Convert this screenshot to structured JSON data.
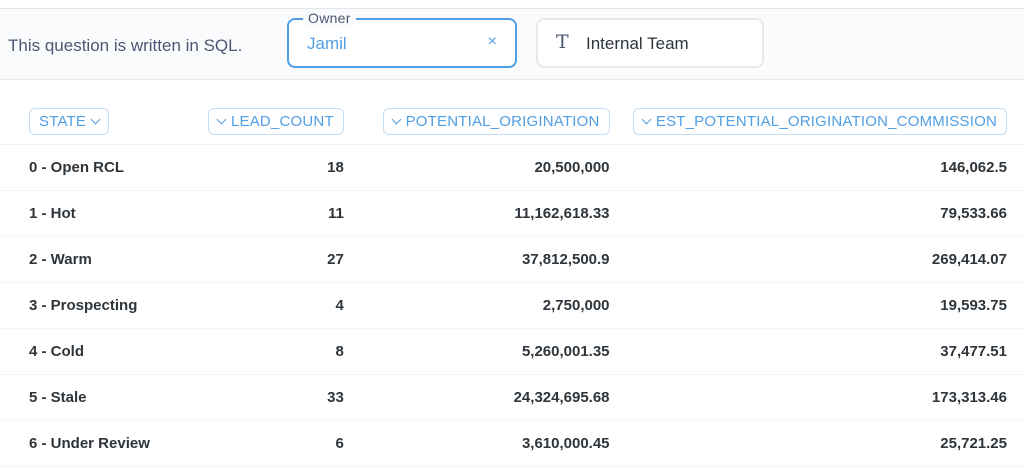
{
  "filter_bar": {
    "note": "This question is written in SQL.",
    "owner_filter": {
      "legend": "Owner",
      "value": "Jamil",
      "clear_icon": "×"
    },
    "team_filter": {
      "type_icon": "T",
      "label": "Internal Team"
    }
  },
  "table": {
    "columns": [
      "STATE",
      "LEAD_COUNT",
      "POTENTIAL_ORIGINATION",
      "EST_POTENTIAL_ORIGINATION_COMMISSION"
    ],
    "rows": [
      [
        "0 - Open RCL",
        "18",
        "20,500,000",
        "146,062.5"
      ],
      [
        "1 - Hot",
        "11",
        "11,162,618.33",
        "79,533.66"
      ],
      [
        "2 - Warm",
        "27",
        "37,812,500.9",
        "269,414.07"
      ],
      [
        "3 - Prospecting",
        "4",
        "2,750,000",
        "19,593.75"
      ],
      [
        "4 - Cold",
        "8",
        "5,260,001.35",
        "37,477.51"
      ],
      [
        "5 - Stale",
        "33",
        "24,324,695.68",
        "173,313.46"
      ],
      [
        "6 - Under Review",
        "6",
        "3,610,000.45",
        "25,721.25"
      ]
    ]
  },
  "colors": {
    "accent": "#509ee3",
    "text": "#2e353b",
    "muted": "#4c5773"
  }
}
